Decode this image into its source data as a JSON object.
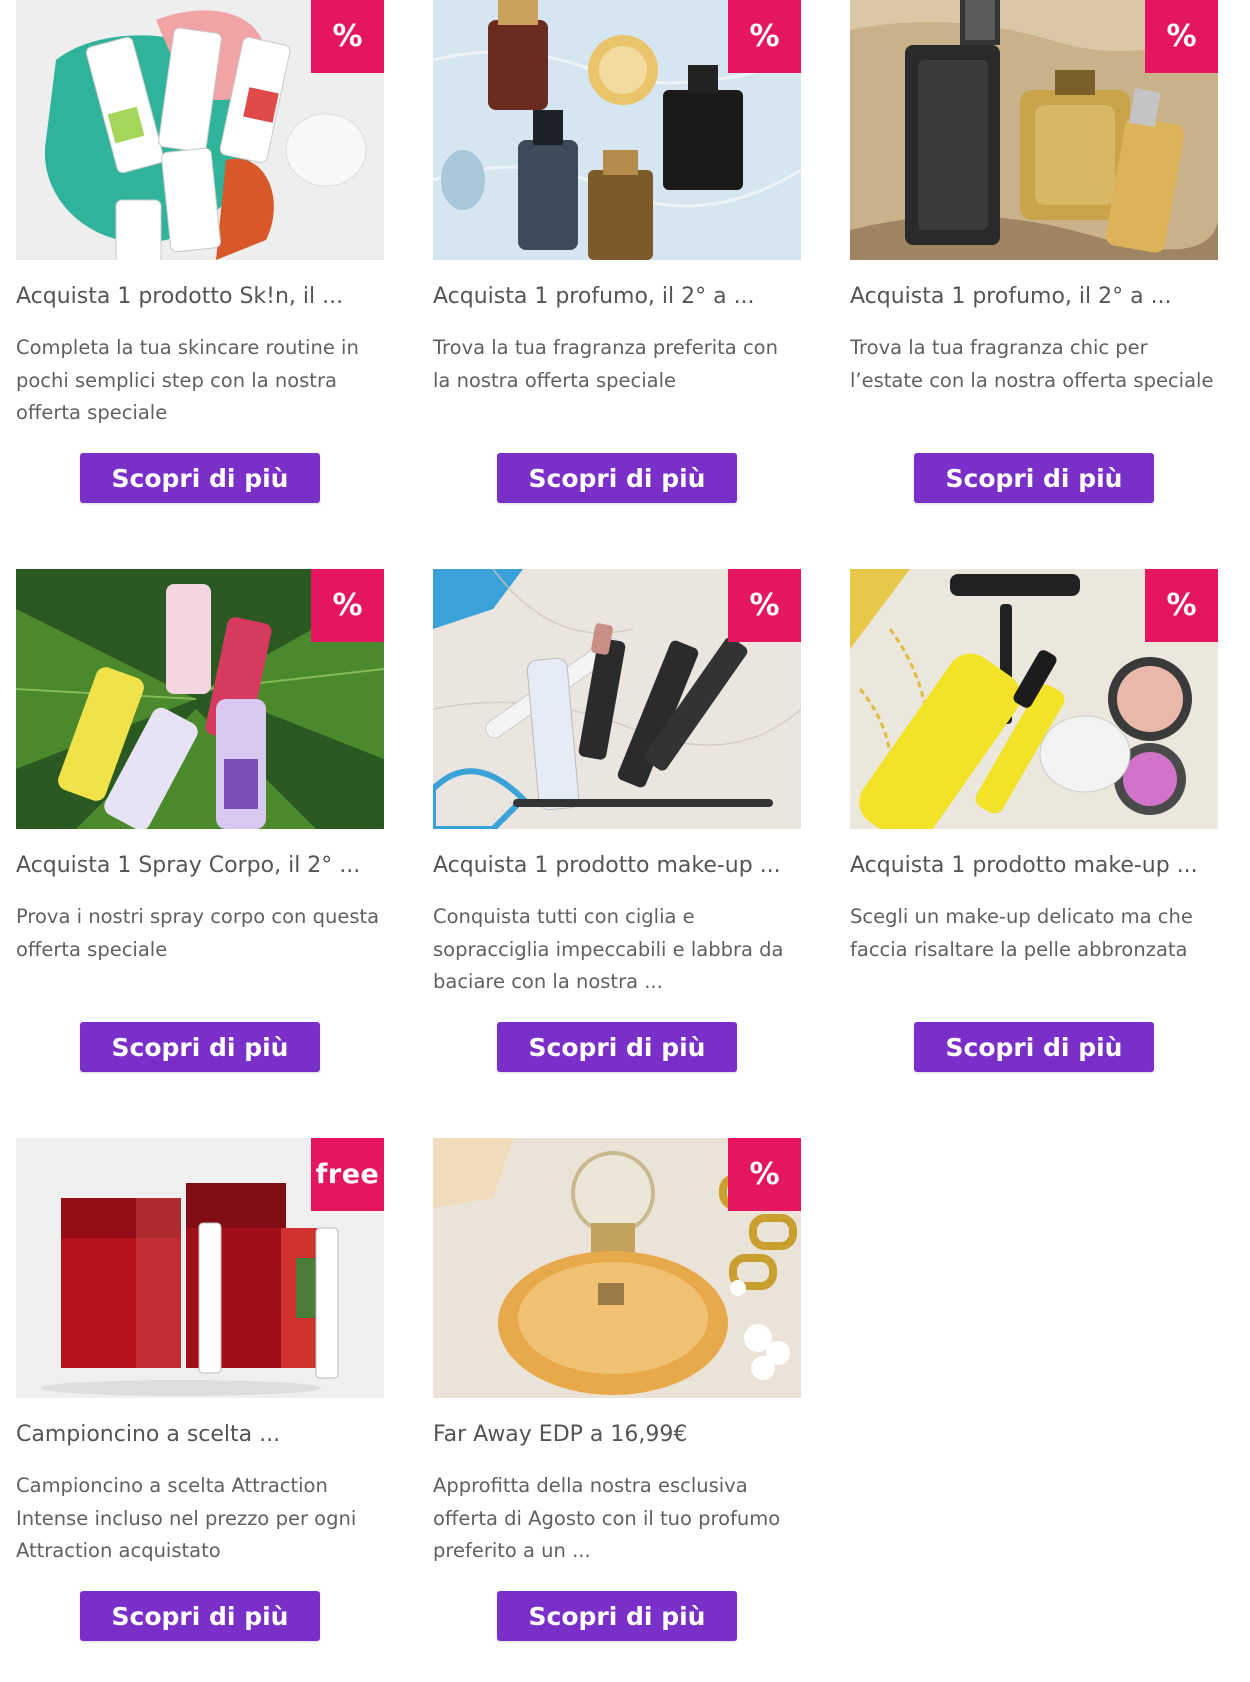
{
  "colors": {
    "badge": "#e5165f",
    "button": "#7b2fc9",
    "title_text": "#555555",
    "body_text": "#606060"
  },
  "cards": [
    {
      "badge": "%",
      "title": "Acquista 1 prodotto Sk!n, il ...",
      "description": "Completa la tua skincare routine in pochi semplici step con la nostra offerta speciale",
      "button": "Scopri di più",
      "image": "skincare-tubes-photo"
    },
    {
      "badge": "%",
      "title": "Acquista 1 profumo, il 2° a ...",
      "description": "Trova la tua fragranza preferita con la nostra offerta speciale",
      "button": "Scopri di più",
      "image": "perfume-bottles-water-photo"
    },
    {
      "badge": "%",
      "title": "Acquista 1 profumo, il 2° a ...",
      "description": "Trova la tua fragranza chic per l’estate con la nostra offerta speciale",
      "button": "Scopri di più",
      "image": "perfume-bottles-sand-photo"
    },
    {
      "badge": "%",
      "title": "Acquista 1 Spray Corpo, il 2° ...",
      "description": "Prova i nostri spray corpo con questa offerta speciale",
      "button": "Scopri di più",
      "image": "body-spray-leaves-photo"
    },
    {
      "badge": "%",
      "title": "Acquista 1 prodotto make-up ...",
      "description": "Conquista tutti con ciglia e sopracciglia impeccabili e labbra da baciare con la nostra ...",
      "button": "Scopri di più",
      "image": "makeup-marble-photo"
    },
    {
      "badge": "%",
      "title": "Acquista 1 prodotto make-up ...",
      "description": "Scegli un make-up delicato ma che faccia risaltare la pelle abbronzata",
      "button": "Scopri di più",
      "image": "mascara-blush-photo"
    },
    {
      "badge": "free",
      "title": "Campioncino a scelta ...",
      "description": "Campioncino a scelta Attraction Intense incluso nel prezzo per ogni Attraction acquistato",
      "button": "Scopri di più",
      "image": "attraction-boxes-photo"
    },
    {
      "badge": "%",
      "title": "Far Away EDP a 16,99€",
      "description": "Approfitta della nostra esclusiva offerta di Agosto con il tuo profumo preferito a un ...",
      "button": "Scopri di più",
      "image": "far-away-bottle-photo"
    }
  ]
}
